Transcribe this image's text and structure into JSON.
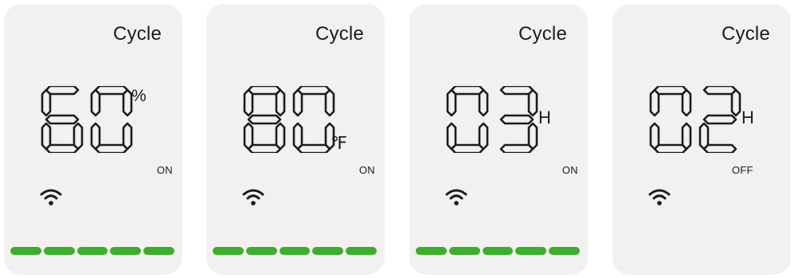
{
  "colors": {
    "card_background": "#f3f1ef",
    "text": "#1c1c1c",
    "progress_lit": "#3dae2b",
    "progress_unlit": "#d9d6d2"
  },
  "cards": [
    {
      "title": "Cycle",
      "value": "60",
      "unit": "%",
      "state": "ON",
      "icon": "wifi-icon",
      "progress_segments_total": 5,
      "progress_segments_lit": 5
    },
    {
      "title": "Cycle",
      "value": "80",
      "unit": "℉",
      "state": "ON",
      "icon": "wifi-icon",
      "progress_segments_total": 5,
      "progress_segments_lit": 5
    },
    {
      "title": "Cycle",
      "value": "03",
      "unit": "H",
      "state": "ON",
      "icon": "wifi-icon",
      "progress_segments_total": 5,
      "progress_segments_lit": 5
    },
    {
      "title": "Cycle",
      "value": "02",
      "unit": "H",
      "state": "OFF",
      "icon": "wifi-icon",
      "progress_segments_total": 5,
      "progress_segments_lit": 0
    }
  ]
}
